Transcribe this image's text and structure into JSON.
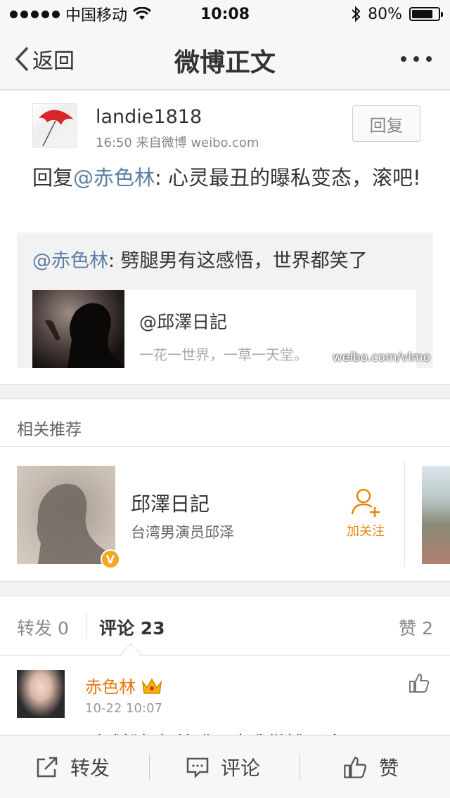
{
  "status_bar": {
    "carrier": "中国移动",
    "time": "10:08",
    "battery": "80%",
    "battery_level": 0.8
  },
  "nav": {
    "back_label": "返回",
    "title": "微博正文"
  },
  "post": {
    "username": "landie1818",
    "meta": "16:50  来自微博 weibo.com",
    "reply_button": "回复",
    "text_prefix": "回复",
    "mention": "@赤色林",
    "text_body": ": 心灵最丑的曝私变态，滚吧!",
    "quote": {
      "mention": "@赤色林",
      "text": ": 劈腿男有这感悟，世界都笑了",
      "card_title": "@邱澤日記",
      "card_desc": "一花一世界，一草一天堂。"
    },
    "watermark": "weibo.com/vlmo"
  },
  "recommendations": {
    "header": "相关推荐",
    "name": "邱澤日記",
    "desc": "台湾男演员邱泽",
    "badge": "V",
    "follow_label": "加关注"
  },
  "tabs": {
    "repost": "转发 0",
    "comment_label": "评论",
    "comment_count": "23",
    "like": "赞 2"
  },
  "comment": {
    "name": "赤色林",
    "time": "10-22 10:07",
    "text": "睡球粉好好管嘴，去我微博评论"
  },
  "toolbar": {
    "repost": "转发",
    "comment": "评论",
    "like": "赞"
  }
}
